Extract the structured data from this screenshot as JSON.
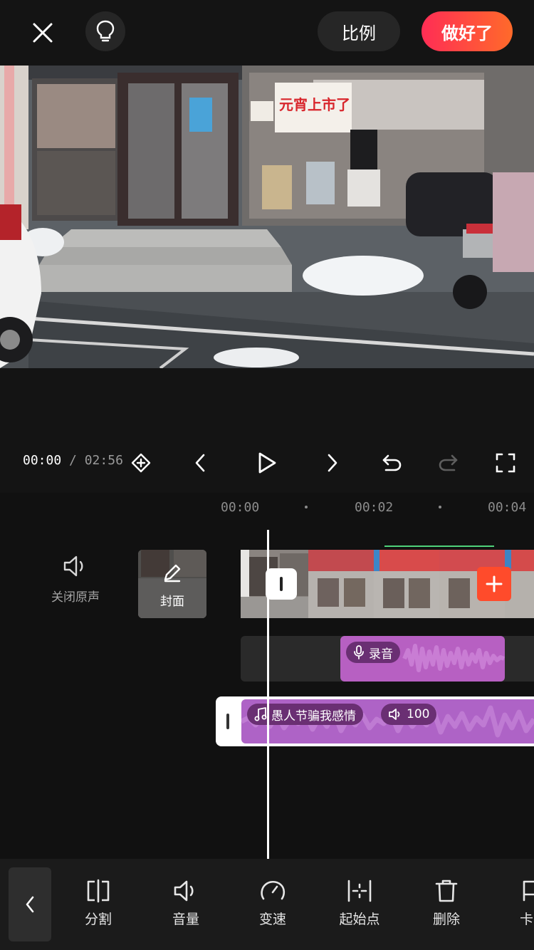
{
  "topbar": {
    "ratio_label": "比例",
    "done_label": "做好了"
  },
  "preview": {
    "poster_text": "元宵上市了"
  },
  "controls": {
    "current_time": "00:00",
    "separator": "/",
    "total_time": "02:56"
  },
  "ruler": {
    "labels": [
      "00:00",
      "00:02",
      "00:04"
    ]
  },
  "timeline": {
    "mute_label": "关闭原声",
    "cover_label": "封面",
    "recording_label": "录音",
    "music_title": "愚人节骗我感情",
    "music_volume": "100"
  },
  "toolbar": {
    "items": [
      {
        "label": "分割",
        "icon": "split-icon"
      },
      {
        "label": "音量",
        "icon": "volume-icon"
      },
      {
        "label": "变速",
        "icon": "speed-icon"
      },
      {
        "label": "起始点",
        "icon": "start-point-icon"
      },
      {
        "label": "删除",
        "icon": "delete-icon"
      },
      {
        "label": "卡",
        "icon": "beat-icon"
      }
    ]
  },
  "colors": {
    "accent_start": "#ff2d55",
    "accent_end": "#ff6a2a",
    "audio_clip": "#b760c2",
    "background": "#141414"
  }
}
